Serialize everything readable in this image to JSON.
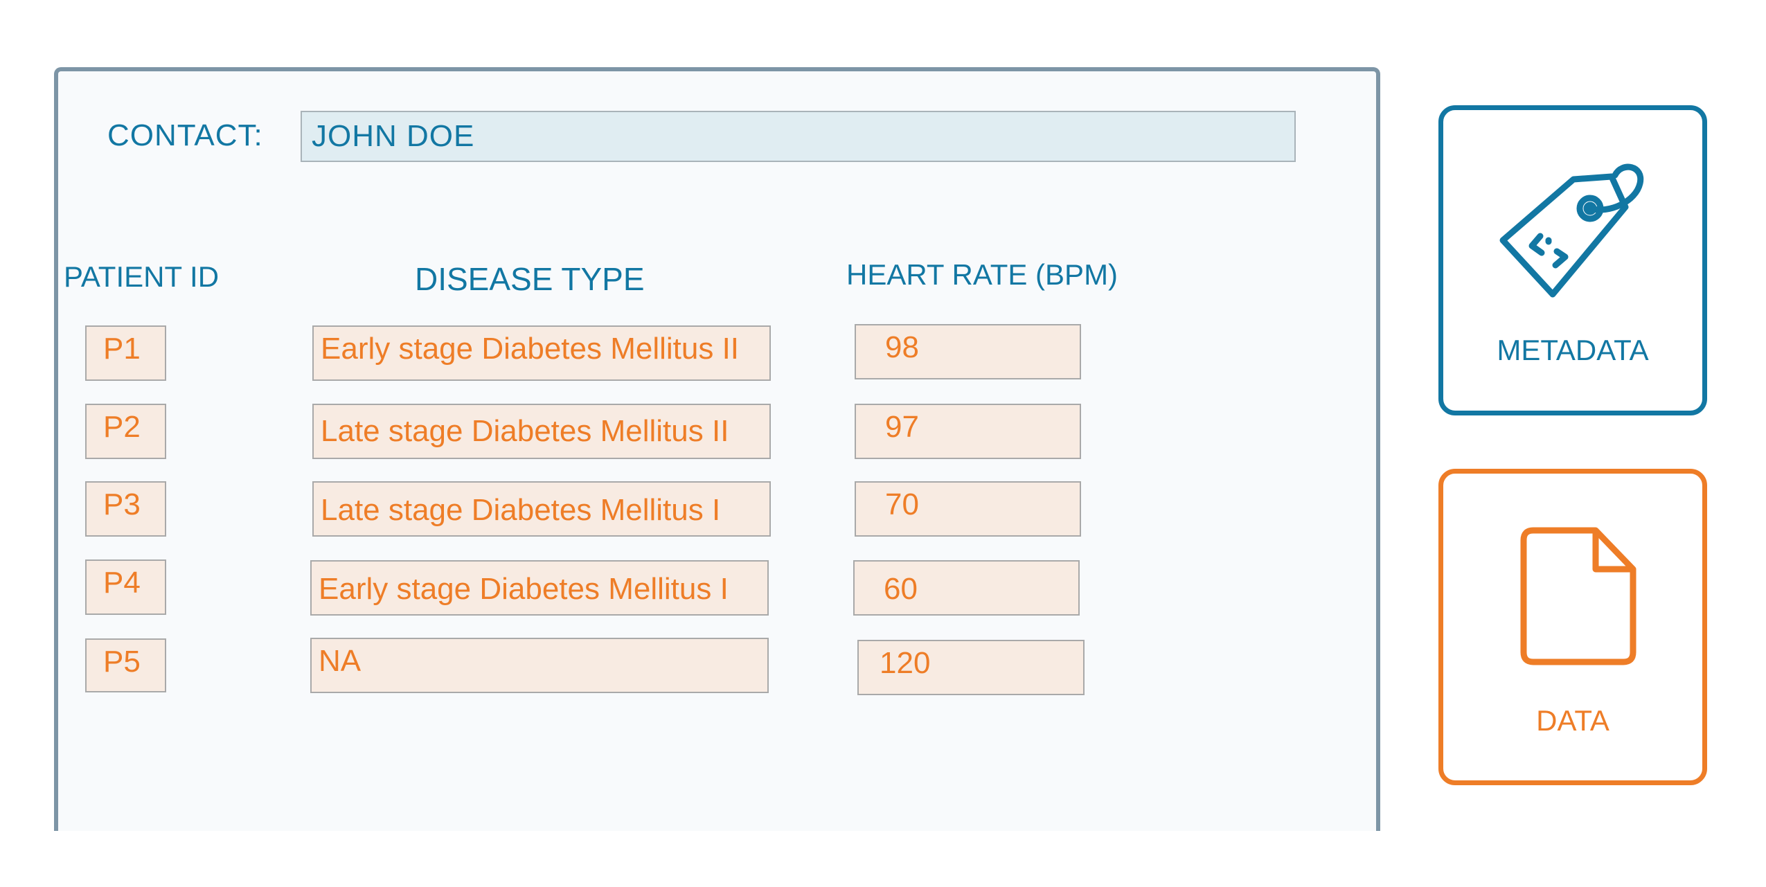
{
  "form": {
    "contact_label": "CONTACT:",
    "contact_value": "JOHN DOE",
    "columns": {
      "patient_id": "PATIENT ID",
      "disease_type": "DISEASE TYPE",
      "heart_rate": "HEART RATE (BPM)"
    },
    "rows": [
      {
        "patient_id": "P1",
        "disease_type": "Early stage Diabetes Mellitus II",
        "heart_rate": "98"
      },
      {
        "patient_id": "P2",
        "disease_type": "Late stage Diabetes Mellitus II",
        "heart_rate": "97"
      },
      {
        "patient_id": "P3",
        "disease_type": "Late stage Diabetes Mellitus I",
        "heart_rate": "70"
      },
      {
        "patient_id": "P4",
        "disease_type": "Early stage Diabetes Mellitus I",
        "heart_rate": "60"
      },
      {
        "patient_id": "P5",
        "disease_type": "NA",
        "heart_rate": "120"
      }
    ]
  },
  "cards": {
    "metadata": {
      "label": "METADATA",
      "icon": "tag-icon"
    },
    "data": {
      "label": "DATA",
      "icon": "document-icon"
    }
  },
  "colors": {
    "accent_blue": "#1277a3",
    "accent_orange": "#ee7d27",
    "panel_border": "#7d95a6",
    "cell_fill": "#f8ebe2",
    "contact_fill": "#e0edf2"
  }
}
